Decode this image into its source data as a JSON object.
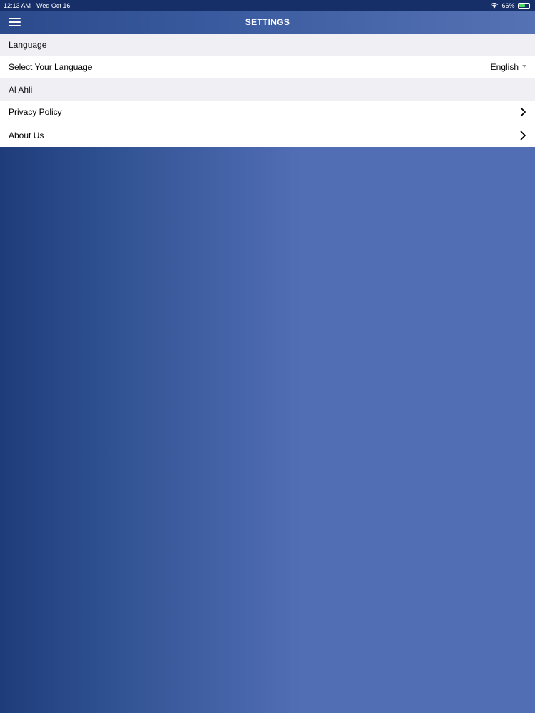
{
  "status_bar": {
    "time": "12:13 AM",
    "date": "Wed Oct 16",
    "battery": "66%",
    "battery_level": 0.66,
    "icons": [
      "wifi-icon",
      "battery-charging-icon"
    ]
  },
  "nav": {
    "title": "SETTINGS",
    "menu_icon": "hamburger-menu-icon"
  },
  "sections": {
    "language": {
      "header": "Language",
      "select_label": "Select Your Language",
      "selected_value": "English"
    },
    "al_ahli": {
      "header": "Al Ahli",
      "privacy_label": "Privacy Policy",
      "about_label": "About Us"
    }
  },
  "colors": {
    "status_bar": "#162f69",
    "accent_gradient_start": "#1f3c7a",
    "accent_gradient_end": "#516db4",
    "section_header_bg": "#efeff4",
    "battery_fill": "#4cd964"
  }
}
